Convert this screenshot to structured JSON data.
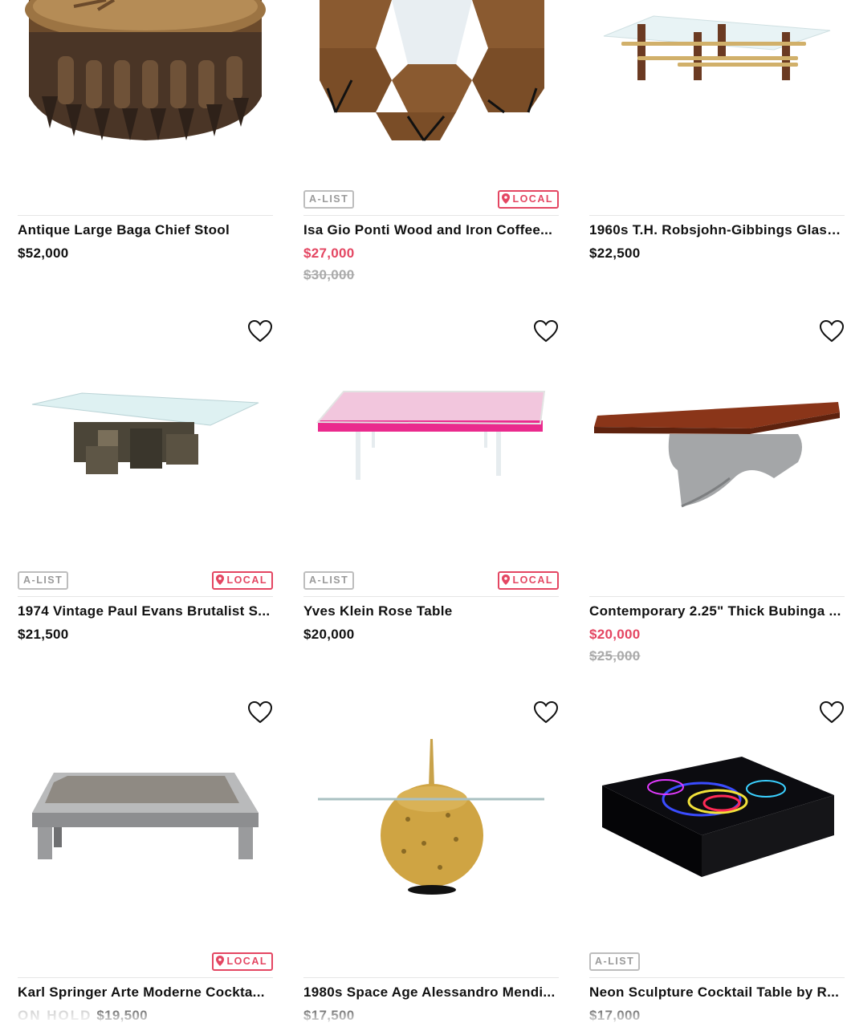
{
  "colors": {
    "accent": "#e44662",
    "muted": "#aaaaaa",
    "text": "#111111",
    "badge_border": "#bdbdbd"
  },
  "products": [
    {
      "title": "Antique Large Baga Chief Stool",
      "price": "$52,000",
      "icon": "carved-wooden-stool-image"
    },
    {
      "title": "Isa Gio Ponti Wood and Iron Coffee...",
      "price": "$27,000",
      "original_price": "$30,000",
      "badge_alist": "A-LIST",
      "badge_local": "LOCAL",
      "icon": "hexagon-wood-coffee-table-image"
    },
    {
      "title": "1960s T.H. Robsjohn-Gibbings Glass...",
      "price": "$22,500",
      "icon": "glass-brass-coffee-table-image"
    },
    {
      "title": "1974 Vintage Paul Evans Brutalist S...",
      "price": "$21,500",
      "badge_alist": "A-LIST",
      "badge_local": "LOCAL",
      "icon": "brutalist-glass-table-image"
    },
    {
      "title": "Yves Klein Rose Table",
      "price": "$20,000",
      "badge_alist": "A-LIST",
      "badge_local": "LOCAL",
      "icon": "pink-rose-table-image"
    },
    {
      "title": "Contemporary 2.25\" Thick Bubinga ...",
      "price": "$20,000",
      "original_price": "$25,000",
      "icon": "bubinga-wood-table-image"
    },
    {
      "title": "Karl Springer Arte Moderne Cockta...",
      "price": "$19,500",
      "status": "ON HOLD",
      "badge_local": "LOCAL",
      "icon": "chrome-smoked-glass-table-image"
    },
    {
      "title": "1980s Space Age Alessandro Mendi...",
      "price": "$17,500",
      "icon": "gold-sphere-table-image"
    },
    {
      "title": "Neon Sculpture Cocktail Table by R...",
      "price": "$17,000",
      "badge_alist": "A-LIST",
      "icon": "neon-cube-table-image"
    }
  ]
}
